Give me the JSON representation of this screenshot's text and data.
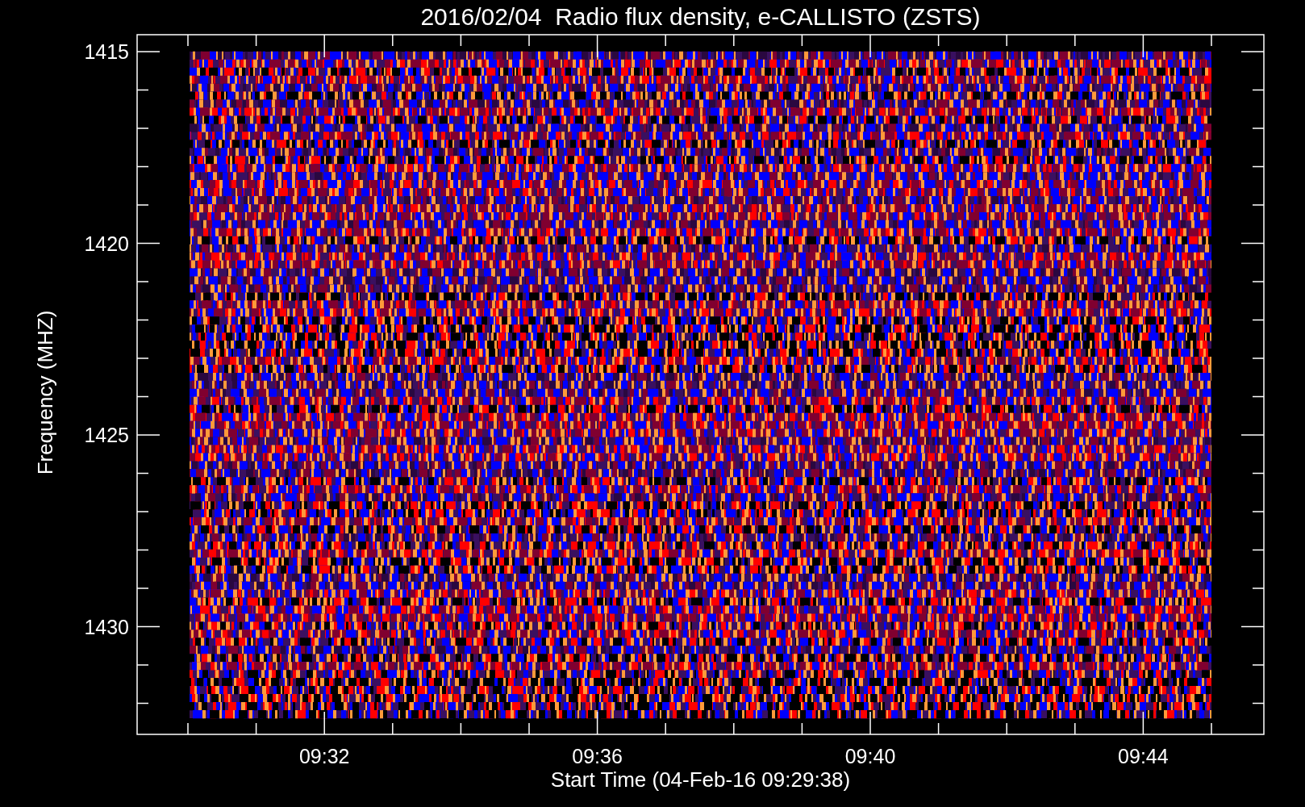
{
  "title": "2016/02/04  Radio flux density, e-CALLISTO (ZSTS)",
  "y_axis": {
    "label": "Frequency (MHZ)",
    "ticks": [
      "1415",
      "1420",
      "1425",
      "1430"
    ]
  },
  "x_axis": {
    "label": "Start Time (04-Feb-16 09:29:38)",
    "ticks": [
      "09:32",
      "09:36",
      "09:40",
      "09:44"
    ]
  }
}
